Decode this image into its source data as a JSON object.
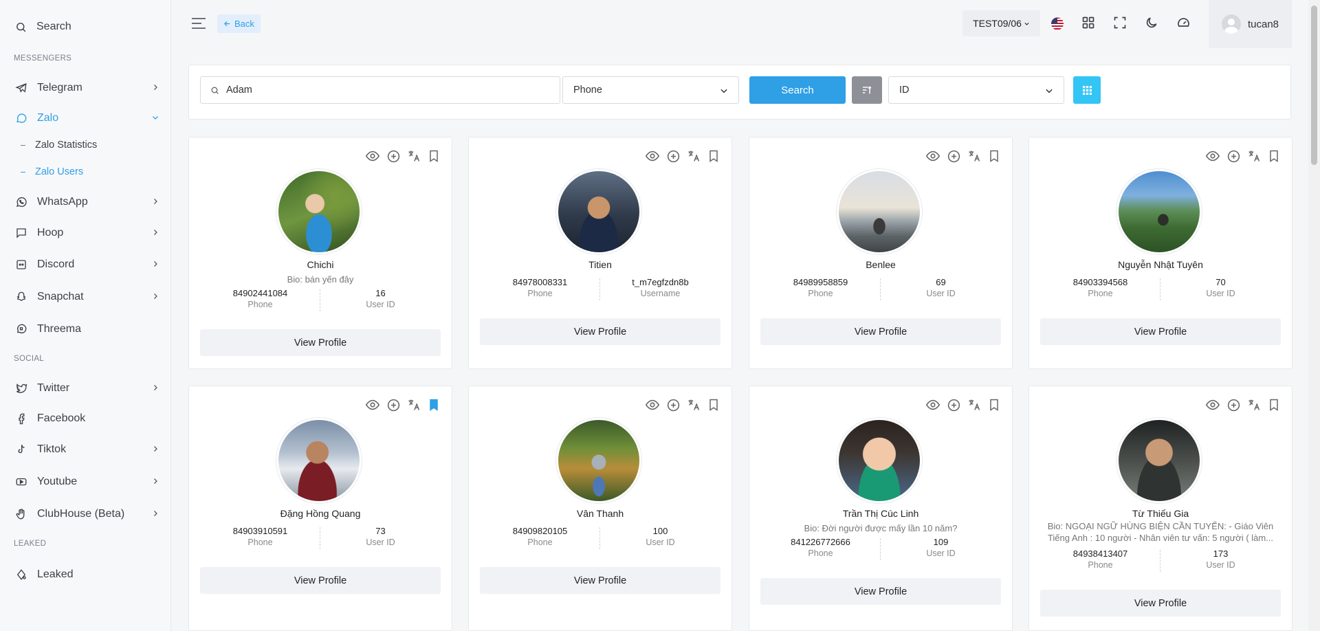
{
  "sidebar": {
    "search_label": "Search",
    "sections": {
      "messengers": "MESSENGERS",
      "social": "SOCIAL",
      "leaked": "LEAKED"
    },
    "items": {
      "telegram": "Telegram",
      "zalo": "Zalo",
      "zalo_statistics": "Zalo Statistics",
      "zalo_users": "Zalo Users",
      "whatsapp": "WhatsApp",
      "hoop": "Hoop",
      "discord": "Discord",
      "snapchat": "Snapchat",
      "threema": "Threema",
      "twitter": "Twitter",
      "facebook": "Facebook",
      "tiktok": "Tiktok",
      "youtube": "Youtube",
      "clubhouse": "ClubHouse (Beta)",
      "leaked": "Leaked"
    },
    "accent_color": "#2f9fe6"
  },
  "topbar": {
    "back_label": "Back",
    "project": "TEST09/06",
    "username": "tucan8",
    "icons": [
      "menu-icon",
      "us-flag-icon",
      "apps-grid-icon",
      "fullscreen-icon",
      "moon-icon",
      "dashboard-gauge-icon"
    ]
  },
  "filter": {
    "search_value": "Adam",
    "field_select": "Phone",
    "search_button": "Search",
    "sort_select": "ID"
  },
  "cards": [
    {
      "name": "Chichi",
      "bio": "Bio: bán yến đây",
      "stat1_value": "84902441084",
      "stat1_label": "Phone",
      "stat2_value": "16",
      "stat2_label": "User ID",
      "view": "View Profile",
      "bookmarked": false
    },
    {
      "name": "Titien",
      "bio": "",
      "stat1_value": "84978008331",
      "stat1_label": "Phone",
      "stat2_value": "t_m7egfzdn8b",
      "stat2_label": "Username",
      "view": "View Profile",
      "bookmarked": false
    },
    {
      "name": "Benlee",
      "bio": "",
      "stat1_value": "84989958859",
      "stat1_label": "Phone",
      "stat2_value": "69",
      "stat2_label": "User ID",
      "view": "View Profile",
      "bookmarked": false
    },
    {
      "name": "Nguyễn Nhật Tuyên",
      "bio": "",
      "stat1_value": "84903394568",
      "stat1_label": "Phone",
      "stat2_value": "70",
      "stat2_label": "User ID",
      "view": "View Profile",
      "bookmarked": false
    },
    {
      "name": "Đặng Hồng Quang",
      "bio": "",
      "stat1_value": "84903910591",
      "stat1_label": "Phone",
      "stat2_value": "73",
      "stat2_label": "User ID",
      "view": "View Profile",
      "bookmarked": true
    },
    {
      "name": "Vân Thanh",
      "bio": "",
      "stat1_value": "84909820105",
      "stat1_label": "Phone",
      "stat2_value": "100",
      "stat2_label": "User ID",
      "view": "View Profile",
      "bookmarked": false
    },
    {
      "name": "Trần Thị Cúc Linh",
      "bio": "Bio: Đời người được mấy lần 10 năm?",
      "stat1_value": "841226772666",
      "stat1_label": "Phone",
      "stat2_value": "109",
      "stat2_label": "User ID",
      "view": "View Profile",
      "bookmarked": false
    },
    {
      "name": "Từ Thiếu Gia",
      "bio": "Bio: NGOẠI NGỮ HÙNG BIỆN CẦN TUYỂN: - Giáo Viên Tiếng Anh : 10 người - Nhân viên tư vấn: 5 người ( làm...",
      "stat1_value": "84938413407",
      "stat1_label": "Phone",
      "stat2_value": "173",
      "stat2_label": "User ID",
      "view": "View Profile",
      "bookmarked": false
    }
  ]
}
